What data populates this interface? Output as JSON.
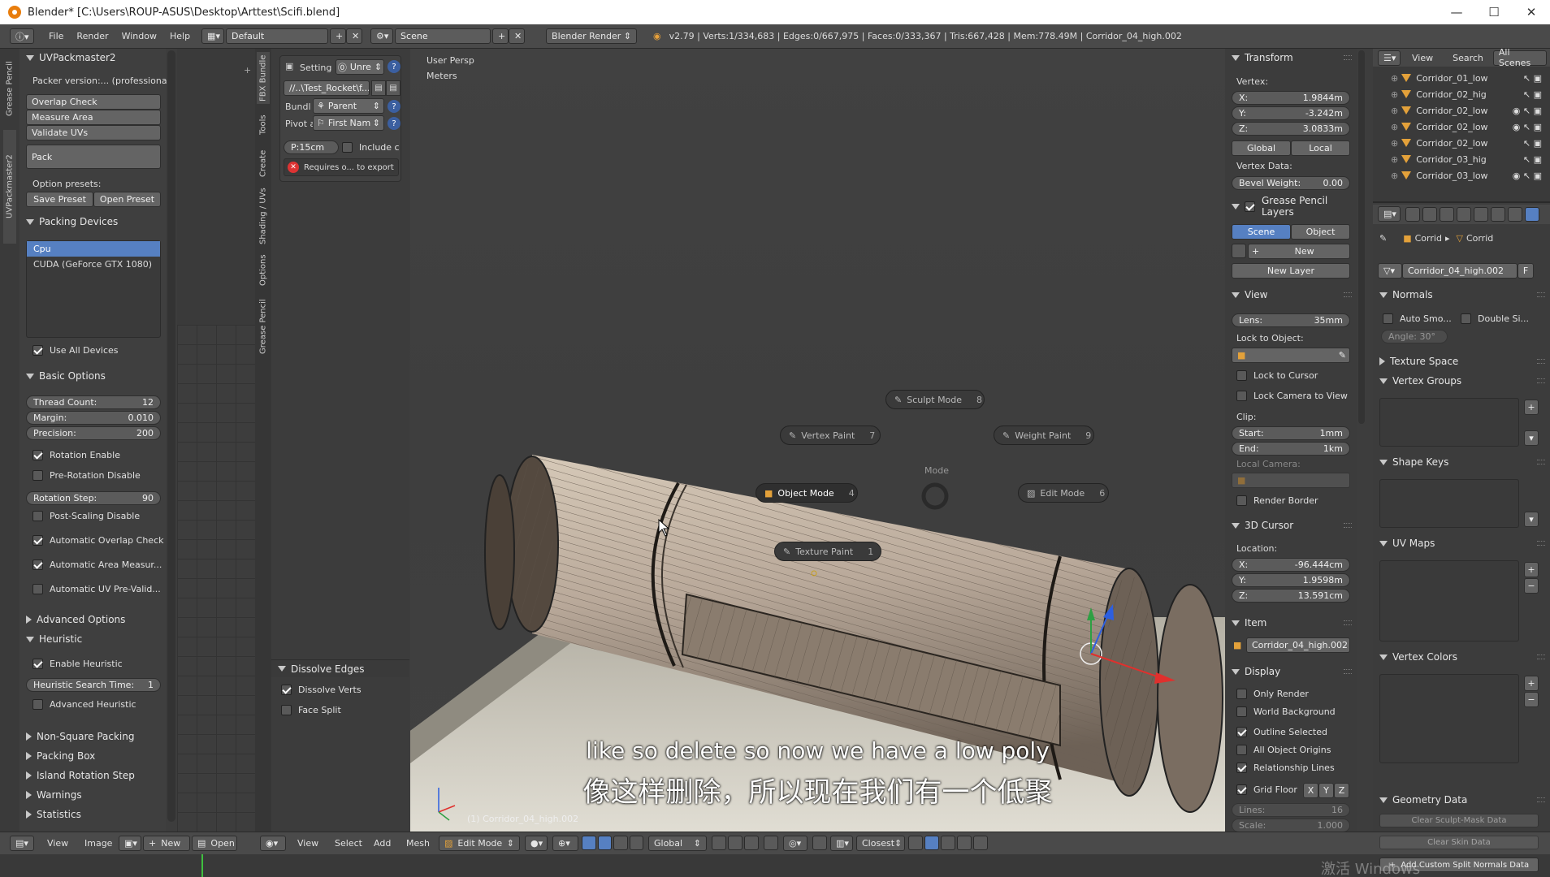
{
  "window": {
    "title": "Blender* [C:\\Users\\ROUP-ASUS\\Desktop\\Arttest\\Scifi.blend]",
    "minimize": "—",
    "maximize": "☐",
    "close": "✕"
  },
  "menubar": {
    "items": [
      "File",
      "Render",
      "Window",
      "Help"
    ],
    "layout": "Default",
    "scene": "Scene",
    "engine": "Blender Render",
    "stats": "v2.79 | Verts:1/334,683 | Edges:0/667,975 | Faces:0/333,367 | Tris:667,428 | Mem:778.49M | Corridor_04_high.002"
  },
  "uv_panel": {
    "vtabs": [
      "Grease Pencil",
      "UVPackmaster2"
    ],
    "title": "UVPackmaster2",
    "version": "Packer version:... (professional)",
    "overlap_check": "Overlap Check",
    "measure_area": "Measure Area",
    "validate_uvs": "Validate UVs",
    "pack": "Pack",
    "option_presets": "Option presets:",
    "save_preset": "Save Preset",
    "open_preset": "Open Preset",
    "packing_devices": "Packing Devices",
    "devices": [
      "Cpu",
      "CUDA (GeForce GTX 1080)"
    ],
    "use_all_devices": "Use All Devices",
    "basic_options": "Basic Options",
    "thread_count_label": "Thread Count:",
    "thread_count": "12",
    "margin_label": "Margin:",
    "margin": "0.010",
    "precision_label": "Precision:",
    "precision": "200",
    "rotation_enable": "Rotation Enable",
    "pre_rotation_disable": "Pre-Rotation Disable",
    "rotation_step_label": "Rotation Step:",
    "rotation_step": "90",
    "post_scaling_disable": "Post-Scaling Disable",
    "auto_overlap": "Automatic Overlap Check",
    "auto_area": "Automatic Area Measur...",
    "auto_uv_pre": "Automatic UV Pre-Valid...",
    "advanced_options": "Advanced Options",
    "heuristic": "Heuristic",
    "enable_heuristic": "Enable Heuristic",
    "heuristic_time_label": "Heuristic Search Time:",
    "heuristic_time": "1",
    "advanced_heuristic": "Advanced Heuristic",
    "non_square": "Non-Square Packing",
    "packing_box": "Packing Box",
    "island_rotation": "Island Rotation Step",
    "warnings": "Warnings",
    "statistics": "Statistics"
  },
  "tool_panel": {
    "vtabs": [
      "FBX Bundle",
      "Tools",
      "Create",
      "Shading / UVs",
      "Options",
      "Grease Pencil"
    ],
    "setting": "Setting",
    "unre": "Unre",
    "path": "//..\\Test_Rocket\\f...",
    "bundl": "Bundl",
    "parent": "Parent",
    "pivot": "Pivot a",
    "first_name": "First Nam",
    "p15": "P:15cm",
    "include": "Include c",
    "requires": "Requires o... to export",
    "dissolve_edges": "Dissolve Edges",
    "dissolve_verts": "Dissolve Verts",
    "face_split": "Face Split"
  },
  "viewport": {
    "view_name": "User Persp",
    "units": "Meters",
    "object_name": "(1) Corridor_04_high.002",
    "pie_title": "Mode",
    "pie": {
      "sculpt": "Sculpt Mode",
      "sculpt_key": "8",
      "vertex_paint": "Vertex Paint",
      "vertex_paint_key": "7",
      "weight_paint": "Weight Paint",
      "weight_paint_key": "9",
      "object_mode": "Object Mode",
      "object_mode_key": "4",
      "edit_mode": "Edit Mode",
      "edit_mode_key": "6",
      "texture_paint": "Texture Paint",
      "texture_paint_key": "1"
    },
    "subtitle_en": "like so delete so now we have a low poly",
    "subtitle_zh": "像这样删除，所以现在我们有一个低聚"
  },
  "n_panel": {
    "transform": "Transform",
    "vertex": "Vertex:",
    "x_label": "X:",
    "x": "1.9844m",
    "y_label": "Y:",
    "y": "-3.242m",
    "z_label": "Z:",
    "z": "3.0833m",
    "global": "Global",
    "local": "Local",
    "vertex_data": "Vertex Data:",
    "bevel_label": "Bevel Weight:",
    "bevel": "0.00",
    "gp_layers": "Grease Pencil Layers",
    "scene": "Scene",
    "object": "Object",
    "new": "New",
    "new_layer": "New Layer",
    "view": "View",
    "lens_label": "Lens:",
    "lens": "35mm",
    "lock_to_object": "Lock to Object:",
    "lock_to_cursor": "Lock to Cursor",
    "lock_camera": "Lock Camera to View",
    "clip": "Clip:",
    "start_label": "Start:",
    "start": "1mm",
    "end_label": "End:",
    "end": "1km",
    "local_camera": "Local Camera:",
    "render_border": "Render Border",
    "cursor": "3D Cursor",
    "location": "Location:",
    "cx": "-96.444cm",
    "cy": "1.9598m",
    "cz": "13.591cm",
    "item": "Item",
    "item_name": "Corridor_04_high.002",
    "display": "Display",
    "only_render": "Only Render",
    "world_bg": "World Background",
    "outline_selected": "Outline Selected",
    "all_origins": "All Object Origins",
    "relationship": "Relationship Lines",
    "grid_floor": "Grid Floor",
    "gx": "X",
    "gy": "Y",
    "gz": "Z",
    "lines_label": "Lines:",
    "lines": "16",
    "scale_label": "Scale:",
    "scale": "1.000"
  },
  "outliner": {
    "view": "View",
    "search": "Search",
    "all_scenes": "All Scenes",
    "rows": [
      "Corridor_01_low",
      "Corridor_02_hig",
      "Corridor_02_low",
      "Corridor_02_low",
      "Corridor_02_low",
      "Corridor_03_hig",
      "Corridor_03_low"
    ]
  },
  "properties": {
    "crumb1": "Corrid",
    "crumb2": "Corrid",
    "mesh_name": "Corridor_04_high.002",
    "f": "F",
    "normals": "Normals",
    "auto_smooth": "Auto Smo...",
    "double_sided": "Double Si...",
    "angle": "Angle: 30°",
    "texture_space": "Texture Space",
    "vertex_groups": "Vertex Groups",
    "shape_keys": "Shape Keys",
    "uv_maps": "UV Maps",
    "vertex_colors": "Vertex Colors",
    "geometry_data": "Geometry Data",
    "clear_sculpt": "Clear Sculpt-Mask Data",
    "clear_skin": "Clear Skin Data",
    "add_split": "Add Custom Split Normals Data"
  },
  "bottombar": {
    "left": [
      "View",
      "Image"
    ],
    "new": "New",
    "open": "Open",
    "view": "View",
    "select": "Select",
    "add": "Add",
    "mesh": "Mesh",
    "mode": "Edit Mode",
    "orientation": "Global",
    "snap": "Closest"
  },
  "watermark": "激活 Windows",
  "colors": {
    "accent": "#5680c2",
    "blender_orange": "#e87d0d"
  }
}
